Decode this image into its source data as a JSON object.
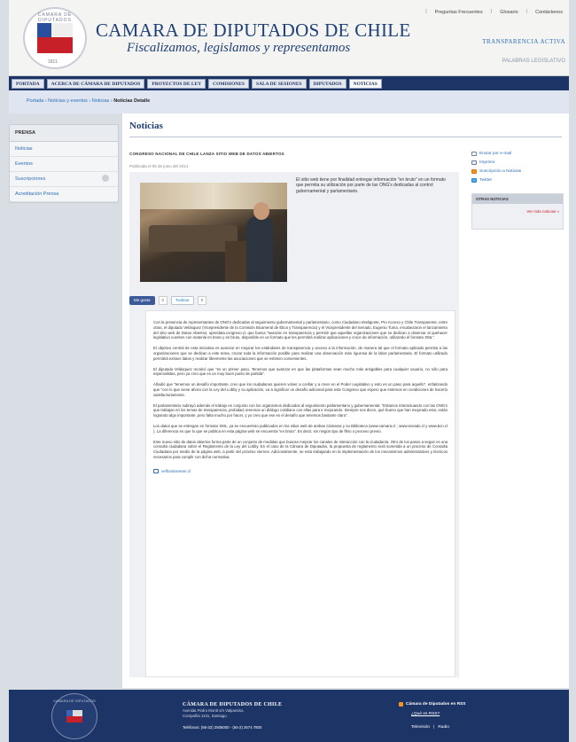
{
  "header": {
    "seal_text": "CAMARA DE DIPUTADOS",
    "seal_year": "1811",
    "title": "CAMARA DE DIPUTADOS DE CHILE",
    "tagline": "Fiscalizamos, legislamos y representamos",
    "top_links": [
      "Preguntas Frecuentes",
      "Glosario",
      "Contáctenos"
    ],
    "transparencia": "TRANSPARENCIA ACTIVA",
    "palabra": "PALABRAS LEGISLATIVO"
  },
  "nav": {
    "items": [
      "PORTADA",
      "ACERCA DE CÁMARA DE DIPUTADOS",
      "PROYECTOS DE LEY",
      "COMISIONES",
      "SALA DE SESIONES",
      "DIPUTADOS",
      "NOTICIAS"
    ],
    "active_index": 6
  },
  "breadcrumb": {
    "items": [
      "Portada",
      "Noticias y eventos",
      "Noticias"
    ],
    "current": "Noticias Detalle",
    "separator": "›"
  },
  "left_menu": {
    "head": "PRENSA",
    "items": [
      "Noticias",
      "Eventos",
      "Suscripciones",
      "Acreditación Prensa"
    ]
  },
  "main": {
    "page_title": "Noticias",
    "headline": "CONGRESO NACIONAL DE CHILE LANZA SITIO WEB DE DATOS ABIERTOS",
    "pubdate": "Publicada el 05 de junio del 2014",
    "teaser": "El sitio web tiene por finalidad entregar información \"en bruto\" en un formato que permita su utilización por parte de las ONG's dedicadas al control gubernamental y parlamentario.",
    "share": {
      "facebook": "Me gusta",
      "fb_count": "0",
      "twitter": "Twittear",
      "tw_count": "0"
    },
    "paragraphs": [
      "Con la presencia de representantes de ONG's dedicadas al seguimiento gubernamental y parlamentario, como Ciudadano Inteligente, Pro Acceso y Chile Transparente, entre otras, el diputado Velásquez (Vicepresidente de la Comisión Bicameral de Ética y Transparencia) y el Vicepresidente del Senado, Eugenio Tuma, encabezaron el lanzamiento del sitio web de Datos Abiertos, opendata.congreso.cl, que busca \"avanzar en transparencia y permitir que aquellas organizaciones que se dedican a observar al quehacer legislativo cuenten con material en bruto y en bruto, disponible en un formato que les permitirá realizar aplicaciones y cruce de información, utilizando el formato XML\".",
      "El objetivo central de esta iniciativa es avanzar en mejorar los estándares de transparencia y acceso a la información, de manera tal que el formato aplicado permita a las organizaciones que se dedican a este tema, cruzar toda la información posible para realizar una observación más rigurosa de la labor parlamentaria. El formato utilizado permitirá extraer datos y realizar libremente las asociaciones que se estimen convenientes.",
      "El diputado Velásquez recalcó que \"es un primer paso. Tenemos que avanzar en que las plataformas sean mucho más amigables para cualquier usuario, no sólo para especialistas, pero ya creo que es un muy buen punto de partida\".",
      "Añadió que \"tenemos un desafío importante, creo que los ciudadanos quieren volver a confiar y a creer en el Poder Legislativo y esto es un paso para aquello\", enfatizando que \"con lo que viene ahora con la Ley del Lobby y su aplicación, va a significar un desafío adicional para este Congreso que espero que estemos en condiciones de hacerlo satisfactoriamente.",
      "El parlamentario subrayó además el trabajo en conjunto con los organismos dedicados al seguimiento parlamentario y gubernamental. \"Estamos interactuando con las ONG's que trabajan en los temas de transparencia, probidad, tenemos un diálogo cotidiano con ellas para ir mejorando. Siempre nos dicen, qué bueno que han mejorado esto, están logrando algo importante, pero falta mucho por hacer, y yo creo que ese es el desafío que tenemos bastante claro\".",
      "Los datos que se entregan en formato XML, ya se encuentran publicados en los sitios web de ambas Cámaras y su Biblioteca (www.camara.cl ; www.senado.cl y www.bcn.cl ). La diferencia es que lo que se publica en esta página web se encuentra \"en bruto\". Es decir, sin ningún tipo de filtro o proceso previo.",
      "Este nuevo sitio de datos abiertos forma parte de un conjunto de medidas que buscan mejorar los canales de interacción con la ciudadanía. Otro de los pasos a seguir es una consulta ciudadana sobre el Reglamento de la Ley del Lobby. En el caso de la Cámara de Diputados, la propuesta de reglamento será sometida a un proceso de Consulta Ciudadana por medio de la página web, a partir del próximo viernes. Adicionalmente, se está trabajando en la implementación de los mecanismos administrativos y técnicos necesarios para cumplir con dicha normativa."
    ],
    "related_link": "velfondoneran.cl"
  },
  "right_tools": {
    "items": [
      "Enviar por e-mail",
      "Imprimir",
      "Suscripción a Noticias",
      "Twitter"
    ],
    "otras_head": "OTRAS NOTICIAS",
    "otras_link": "Ver más noticias »"
  },
  "footer": {
    "seal_text": "CAMARA DE DIPUTADOS",
    "name": "CÁMARA DE DIPUTADOS DE CHILE",
    "address1": "Avenida Pedro Montt s/n Valparaíso,",
    "address2": "Compañía 1131, Santiago.",
    "phone": "Teléfonos: (56-32) 2505000 - (56-2) 2674 7800",
    "rss": "Cámara de Diputados en RSS",
    "rss_q": "¿Qué es RSS?",
    "links": [
      "Televisión",
      "|",
      "Radio"
    ]
  },
  "colors": {
    "navy": "#1d3466",
    "title_blue": "#1f3f76",
    "link_blue": "#2d6db5",
    "red": "#c8202a",
    "rss_orange": "#f39322"
  }
}
